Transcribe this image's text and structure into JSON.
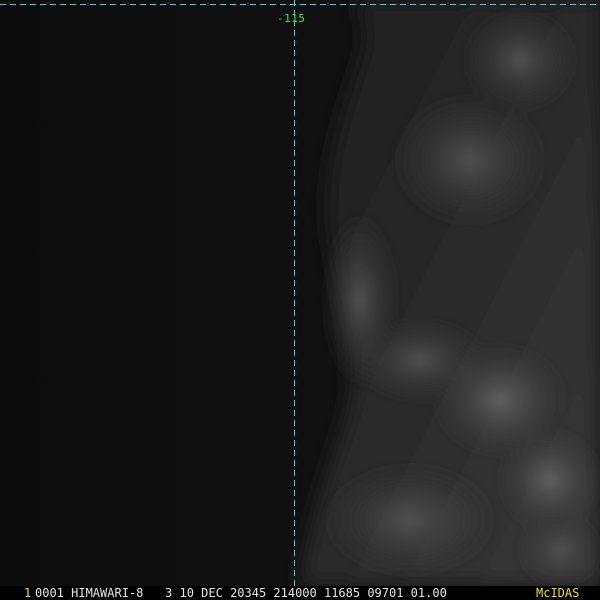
{
  "overlay": {
    "longitude_label": "-115",
    "grid_color": "#33d6d6",
    "label_color": "#3ee83e"
  },
  "footer": {
    "frame_number": "1",
    "info": "0001 HIMAWARI-8   3 10 DEC 20345 214000 11685 09701 01.00",
    "brand": "McIDAS",
    "brand_color": "#f0e000"
  }
}
